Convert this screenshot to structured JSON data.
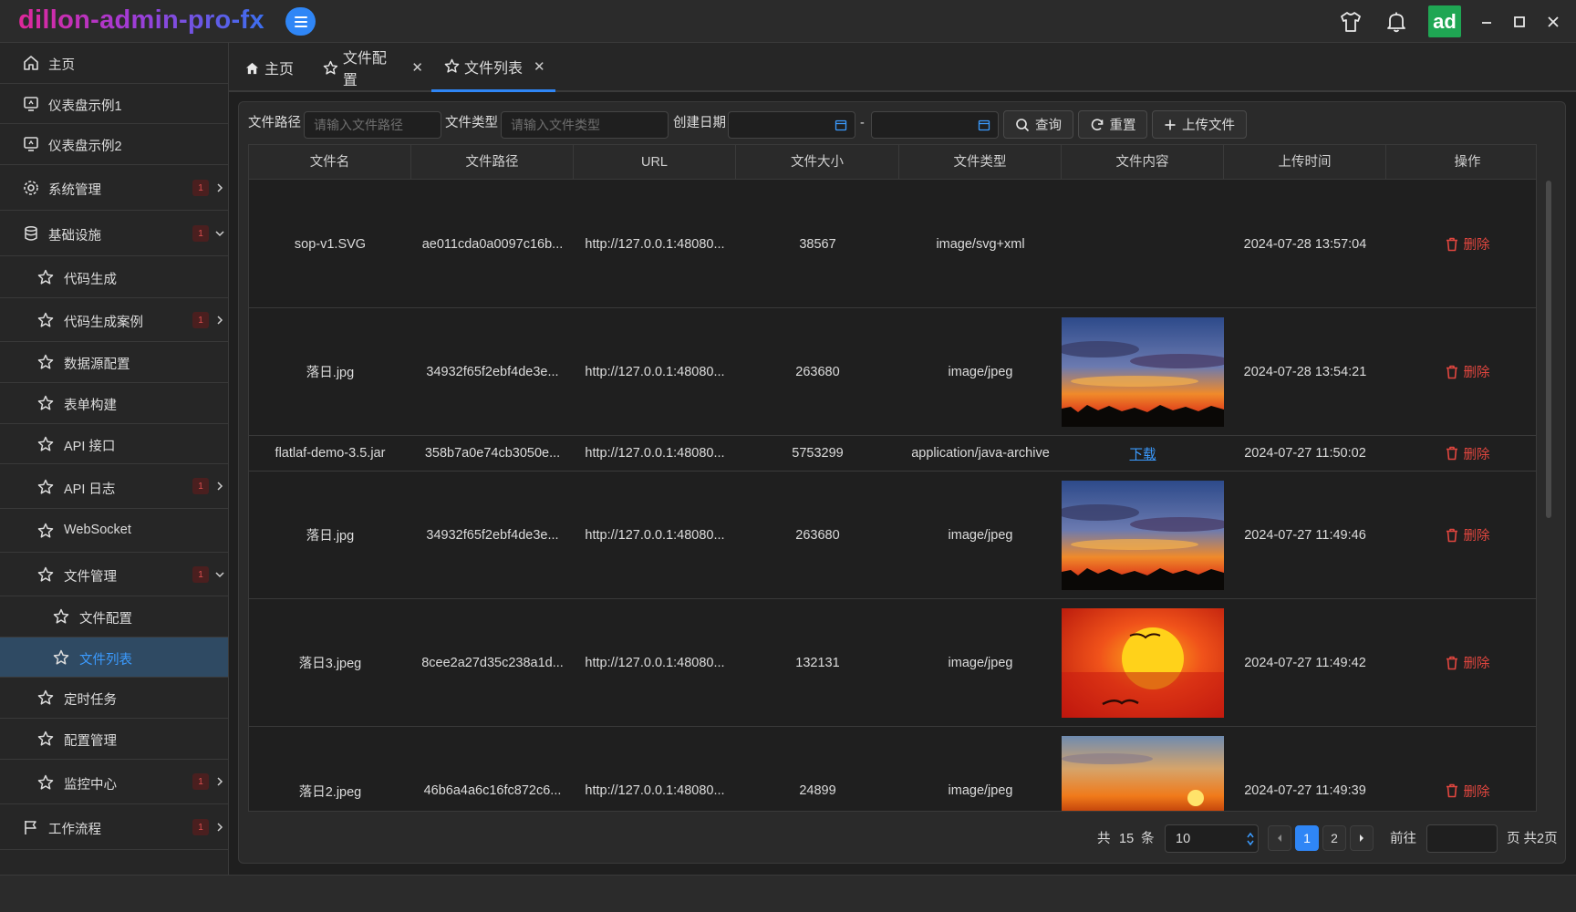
{
  "app": {
    "title": "dillon-admin-pro-fx",
    "avatar_text": "ad"
  },
  "titlebar": {
    "icons": [
      "menu-icon",
      "shirt-icon",
      "bell-icon",
      "minimize-icon",
      "maximize-icon",
      "close-icon"
    ]
  },
  "sidebar": {
    "items": [
      {
        "label": "主页",
        "icon": "home-icon"
      },
      {
        "label": "仪表盘示例1",
        "icon": "dashboard-icon"
      },
      {
        "label": "仪表盘示例2",
        "icon": "dashboard-icon"
      },
      {
        "label": "系统管理",
        "icon": "gear-icon",
        "badge": "1"
      },
      {
        "label": "基础设施",
        "icon": "database-icon",
        "badge": "1"
      },
      {
        "label": "代码生成",
        "icon": "star-icon"
      },
      {
        "label": "代码生成案例",
        "icon": "star-icon",
        "badge": "1"
      },
      {
        "label": "数据源配置",
        "icon": "star-icon"
      },
      {
        "label": "表单构建",
        "icon": "star-icon"
      },
      {
        "label": "API 接口",
        "icon": "star-icon"
      },
      {
        "label": "API 日志",
        "icon": "star-icon",
        "badge": "1"
      },
      {
        "label": "WebSocket",
        "icon": "star-icon"
      },
      {
        "label": "文件管理",
        "icon": "star-icon",
        "badge": "1"
      },
      {
        "label": "文件配置",
        "icon": "star-icon"
      },
      {
        "label": "文件列表",
        "icon": "star-icon"
      },
      {
        "label": "定时任务",
        "icon": "star-icon"
      },
      {
        "label": "配置管理",
        "icon": "star-icon"
      },
      {
        "label": "监控中心",
        "icon": "star-icon",
        "badge": "1"
      },
      {
        "label": "工作流程",
        "icon": "flag-icon",
        "badge": "1"
      }
    ]
  },
  "tabs": [
    {
      "label": "主页",
      "closable": false
    },
    {
      "label": "文件配置",
      "closable": true
    },
    {
      "label": "文件列表",
      "closable": true,
      "active": true
    }
  ],
  "filters": {
    "path_label": "文件路径",
    "path_placeholder": "请输入文件路径",
    "type_label": "文件类型",
    "type_placeholder": "请输入文件类型",
    "date_label": "创建日期",
    "date_separator": "-",
    "query_label": "查询",
    "reset_label": "重置",
    "upload_label": "上传文件"
  },
  "table": {
    "columns": [
      "文件名",
      "文件路径",
      "URL",
      "文件大小",
      "文件类型",
      "文件内容",
      "上传时间",
      "操作"
    ],
    "delete_label": "删除",
    "download_label": "下载",
    "rows": [
      {
        "name": "sop-v1.SVG",
        "path": "ae011cda0a0097c16b...",
        "url": "http://127.0.0.1:48080...",
        "size": "38567",
        "type": "image/svg+xml",
        "content": "none",
        "time": "2024-07-28 13:57:04"
      },
      {
        "name": "落日.jpg",
        "path": "34932f65f2ebf4de3e...",
        "url": "http://127.0.0.1:48080...",
        "size": "263680",
        "type": "image/jpeg",
        "content": "sunset-clouds",
        "time": "2024-07-28 13:54:21"
      },
      {
        "name": "flatlaf-demo-3.5.jar",
        "path": "358b7a0e74cb3050e...",
        "url": "http://127.0.0.1:48080...",
        "size": "5753299",
        "type": "application/java-archive",
        "content": "download",
        "time": "2024-07-27 11:50:02"
      },
      {
        "name": "落日.jpg",
        "path": "34932f65f2ebf4de3e...",
        "url": "http://127.0.0.1:48080...",
        "size": "263680",
        "type": "image/jpeg",
        "content": "sunset-clouds",
        "time": "2024-07-27 11:49:46"
      },
      {
        "name": "落日3.jpeg",
        "path": "8cee2a27d35c238a1d...",
        "url": "http://127.0.0.1:48080...",
        "size": "132131",
        "type": "image/jpeg",
        "content": "sunset-red",
        "time": "2024-07-27 11:49:42"
      },
      {
        "name": "落日2.jpeg",
        "path": "46b6a4a6c16fc872c6...",
        "url": "http://127.0.0.1:48080...",
        "size": "24899",
        "type": "image/jpeg",
        "content": "sunset-sea",
        "time": "2024-07-27 11:49:39"
      }
    ]
  },
  "pagination": {
    "total_prefix": "共",
    "total": "15",
    "total_suffix": "条",
    "page_size": "10",
    "pages": [
      "1",
      "2"
    ],
    "current": "1",
    "goto_label": "前往",
    "page_suffix": "页 共2页"
  },
  "colors": {
    "accent": "#2f86f6",
    "danger": "#e0463f",
    "success": "#1fa653"
  }
}
